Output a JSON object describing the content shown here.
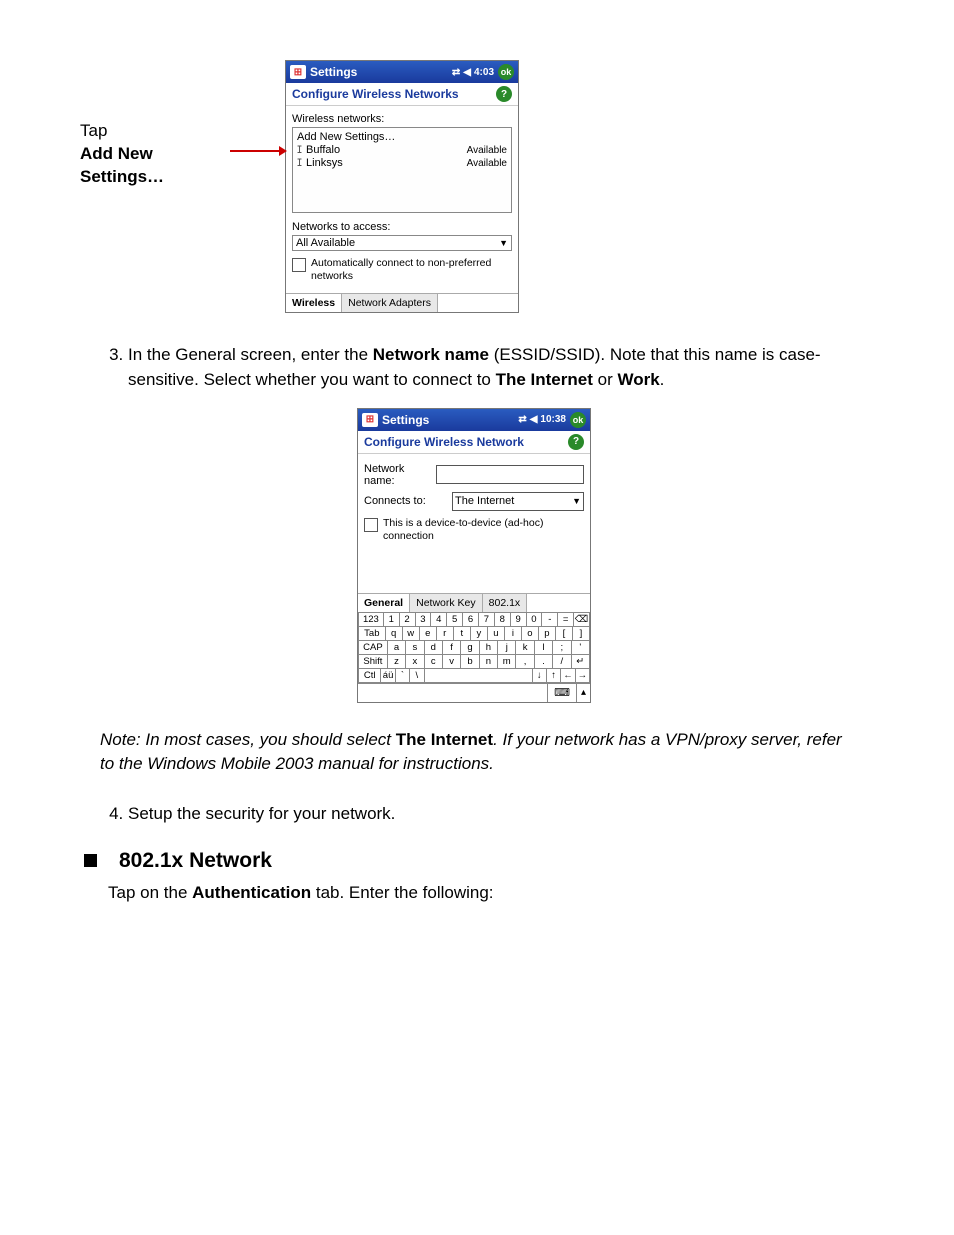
{
  "callout": {
    "line1": "Tap",
    "line2": "Add New",
    "line3": "Settings…"
  },
  "device1": {
    "titlebar": {
      "title": "Settings",
      "time": "4:03",
      "ok": "ok"
    },
    "subbar": "Configure Wireless Networks",
    "labels": {
      "wireless_networks": "Wireless networks:",
      "networks_to_access": "Networks to access:"
    },
    "list": {
      "addnew": "Add New Settings…",
      "items": [
        {
          "name": "Buffalo",
          "status": "Available"
        },
        {
          "name": "Linksys",
          "status": "Available"
        }
      ]
    },
    "access_dropdown": "All Available",
    "auto_connect": "Automatically connect to non-preferred networks",
    "tabs": {
      "wireless": "Wireless",
      "adapters": "Network Adapters"
    }
  },
  "step3": {
    "intro1": "In the General screen, enter the ",
    "network_name_bold": "Network name",
    "intro2": " (ESSID/SSID). Note that this name is case-sensitive. Select whether you want to connect to ",
    "internet_bold": "The Internet",
    "or_text": " or ",
    "work_bold": "Work",
    "period": "."
  },
  "device2": {
    "titlebar": {
      "title": "Settings",
      "time": "10:38",
      "ok": "ok"
    },
    "subbar": "Configure Wireless Network",
    "form": {
      "network_name_label": "Network name:",
      "network_name_value": "",
      "connects_to_label": "Connects to:",
      "connects_to_value": "The Internet",
      "adhoc_text": "This is a device-to-device (ad-hoc) connection"
    },
    "tabs": {
      "general": "General",
      "key": "Network Key",
      "dot1x": "802.1x"
    },
    "keyboard": {
      "row1": [
        "123",
        "1",
        "2",
        "3",
        "4",
        "5",
        "6",
        "7",
        "8",
        "9",
        "0",
        "-",
        "=",
        "⌫"
      ],
      "row2": [
        "Tab",
        "q",
        "w",
        "e",
        "r",
        "t",
        "y",
        "u",
        "i",
        "o",
        "p",
        "[",
        "]"
      ],
      "row3": [
        "CAP",
        "a",
        "s",
        "d",
        "f",
        "g",
        "h",
        "j",
        "k",
        "l",
        ";",
        "'"
      ],
      "row4": [
        "Shift",
        "z",
        "x",
        "c",
        "v",
        "b",
        "n",
        "m",
        ",",
        ".",
        "/",
        "↵"
      ],
      "row5": [
        "Ctl",
        "áü",
        "`",
        "\\",
        "↓",
        "↑",
        "←",
        "→"
      ]
    }
  },
  "note": {
    "lead": "Note: In most cases, you should select ",
    "internet_bold": "The Internet",
    "tail": ". If your network has a VPN/proxy server, refer to the Windows Mobile 2003 manual for instructions."
  },
  "step4": "Setup the security for your network.",
  "section_heading": "802.1x Network",
  "section_body_lead": "Tap on the ",
  "section_body_bold": "Authentication",
  "section_body_tail": " tab. Enter the following:"
}
